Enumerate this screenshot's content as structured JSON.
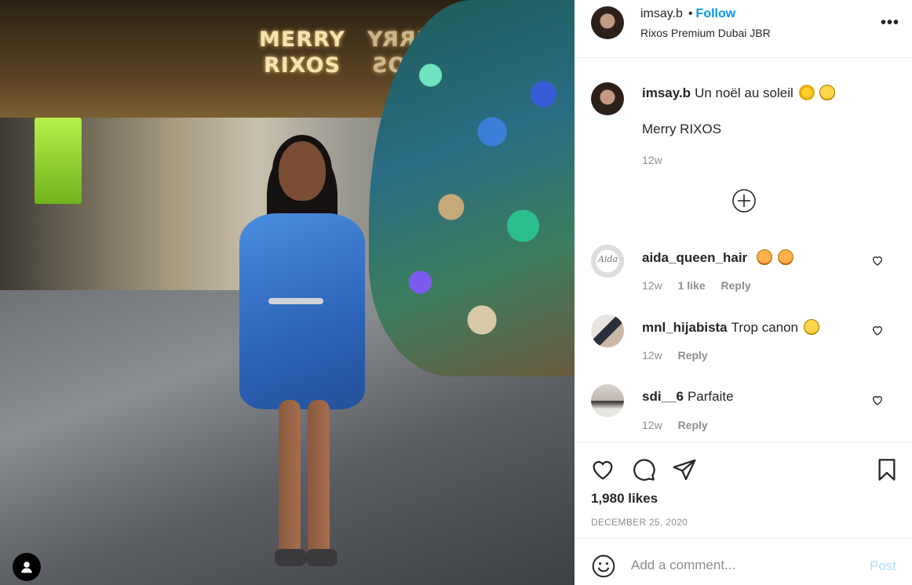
{
  "photo": {
    "signs": [
      "MERRY\nRIXOS",
      "MERRY\nRIXOS"
    ]
  },
  "header": {
    "username": "imsay.b",
    "follow_label": "Follow",
    "location": "Rixos Premium Dubai JBR",
    "more_label": "•••"
  },
  "caption": {
    "username": "imsay.b",
    "text": "Un noël au soleil",
    "line2": "Merry RIXOS",
    "time": "12w"
  },
  "comments": [
    {
      "username": "aida_queen_hair",
      "text": "",
      "time": "12w",
      "likes": "1 like",
      "reply": "Reply"
    },
    {
      "username": "mnl_hijabista",
      "text": "Trop canon",
      "time": "12w",
      "reply": "Reply"
    },
    {
      "username": "sdi__6",
      "text": "Parfaite",
      "time": "12w",
      "reply": "Reply"
    }
  ],
  "actions": {
    "likes": "1,980 likes",
    "date": "DECEMBER 25, 2020"
  },
  "add_comment": {
    "placeholder": "Add a comment...",
    "post_label": "Post"
  },
  "colors": {
    "follow": "#0095f6",
    "post_disabled": "#b2dffc",
    "muted": "#8e8e8e"
  }
}
